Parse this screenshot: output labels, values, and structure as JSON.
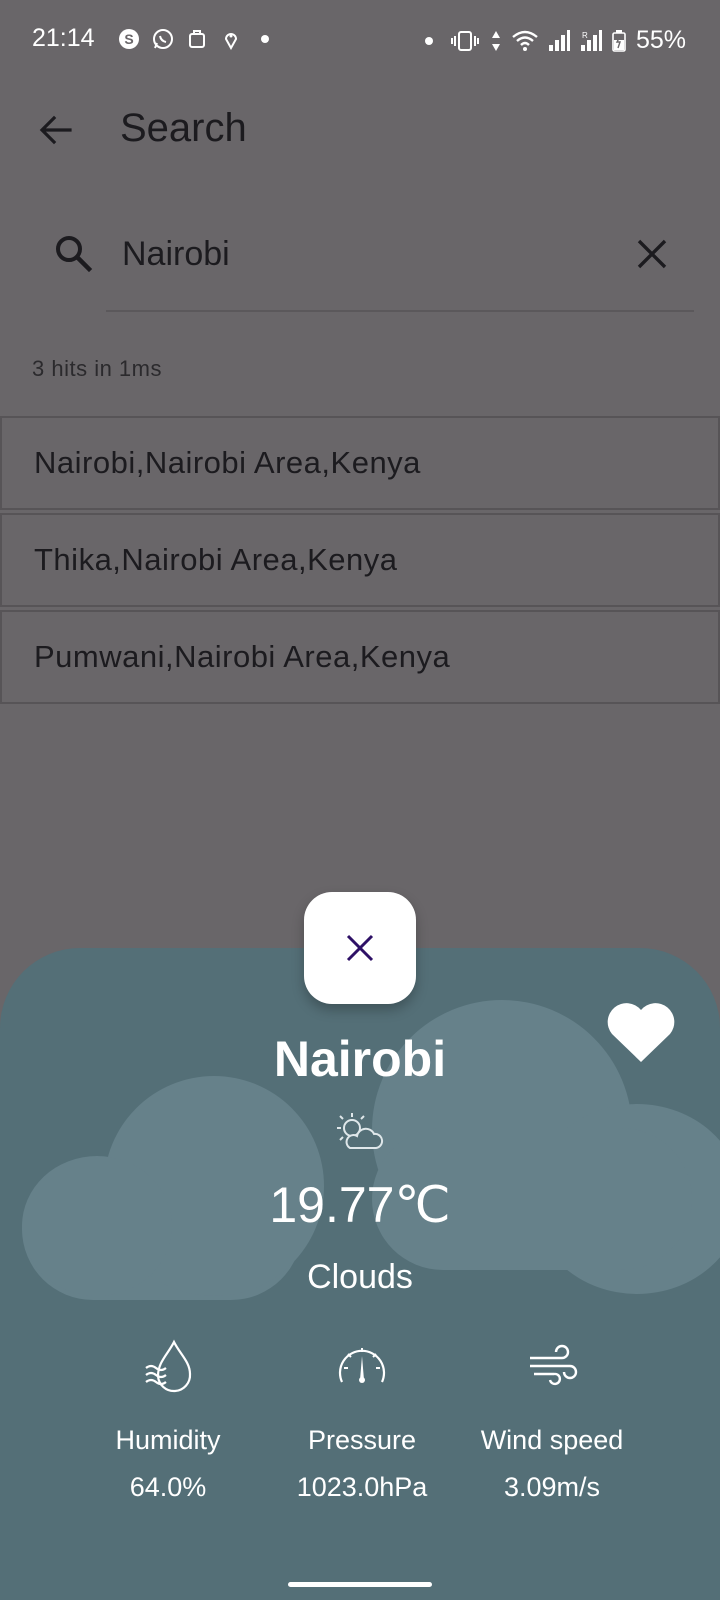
{
  "status_bar": {
    "time": "21:14",
    "battery": "55%",
    "left_icons": [
      "skype-icon",
      "whatsapp-icon",
      "bag-icon",
      "location-pin-icon",
      "dot-icon"
    ],
    "right_icons": [
      "dot-icon",
      "vibrate-icon",
      "data-arrows-icon",
      "wifi-icon",
      "signal-icon",
      "signal-r-icon",
      "battery-icon"
    ]
  },
  "app_bar": {
    "title": "Search"
  },
  "search": {
    "value": "Nairobi",
    "hits_text": "3 hits in 1ms"
  },
  "results": [
    {
      "label": "Nairobi,Nairobi Area,Kenya"
    },
    {
      "label": "Thika,Nairobi Area,Kenya"
    },
    {
      "label": "Pumwani,Nairobi Area,Kenya"
    }
  ],
  "weather_sheet": {
    "city": "Nairobi",
    "temperature": "19.77℃",
    "condition": "Clouds",
    "stats": [
      {
        "label": "Humidity",
        "value": "64.0%",
        "icon": "humidity-icon"
      },
      {
        "label": "Pressure",
        "value": "1023.0hPa",
        "icon": "pressure-gauge-icon"
      },
      {
        "label": "Wind speed",
        "value": "3.09m/s",
        "icon": "wind-icon"
      }
    ]
  },
  "colors": {
    "scrim_background": "#696669",
    "sheet_background": "#546f77",
    "cloud": "#66818a",
    "close_icon": "#2e1066",
    "text_on_sheet": "#ffffff"
  }
}
